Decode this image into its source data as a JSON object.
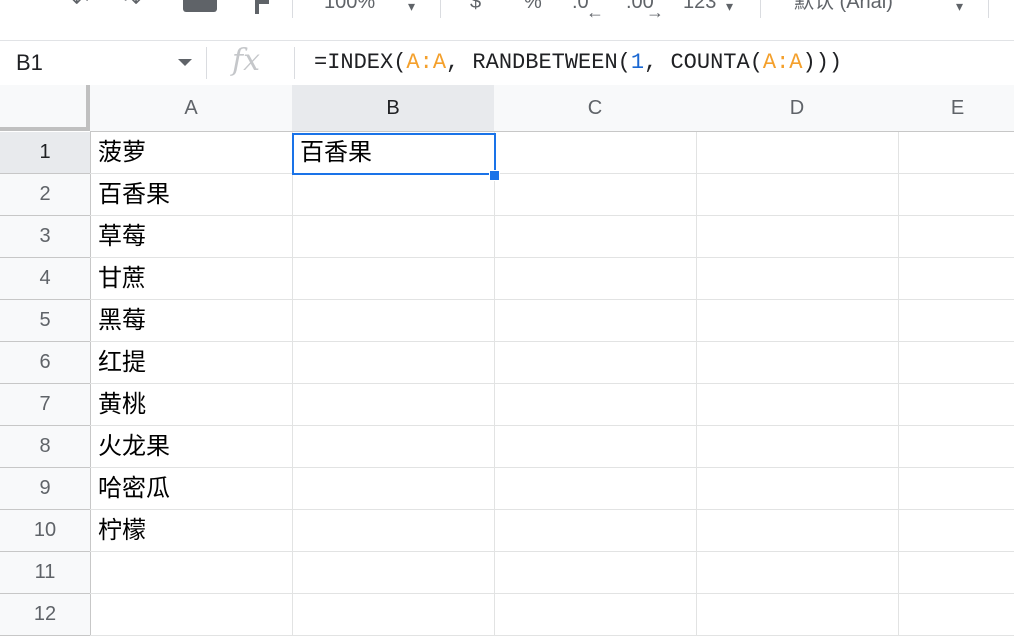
{
  "toolbar": {
    "zoom": "100%",
    "currency": "$",
    "percent": "%",
    "decimal_decrease": ".0",
    "decimal_increase": ".00",
    "number_format": "123",
    "font": "默认 (Arial)"
  },
  "formula_bar": {
    "name_box": "B1",
    "fx": "fx",
    "formula": {
      "prefix": "=INDEX(",
      "ref1": "A:A",
      "mid1": ", RANDBETWEEN(",
      "num": "1",
      "mid2": ", COUNTA(",
      "ref2": "A:A",
      "suffix": ")))"
    }
  },
  "sheet": {
    "columns": [
      "A",
      "B",
      "C",
      "D",
      "E"
    ],
    "rows": [
      "1",
      "2",
      "3",
      "4",
      "5",
      "6",
      "7",
      "8",
      "9",
      "10",
      "11",
      "12"
    ],
    "column_a": [
      "菠萝",
      "百香果",
      "草莓",
      "甘蔗",
      "黑莓",
      "红提",
      "黄桃",
      "火龙果",
      "哈密瓜",
      "柠檬",
      "",
      ""
    ],
    "b1_value": "百香果",
    "selected_cell": "B1",
    "selection_color": "#1a73e8"
  }
}
